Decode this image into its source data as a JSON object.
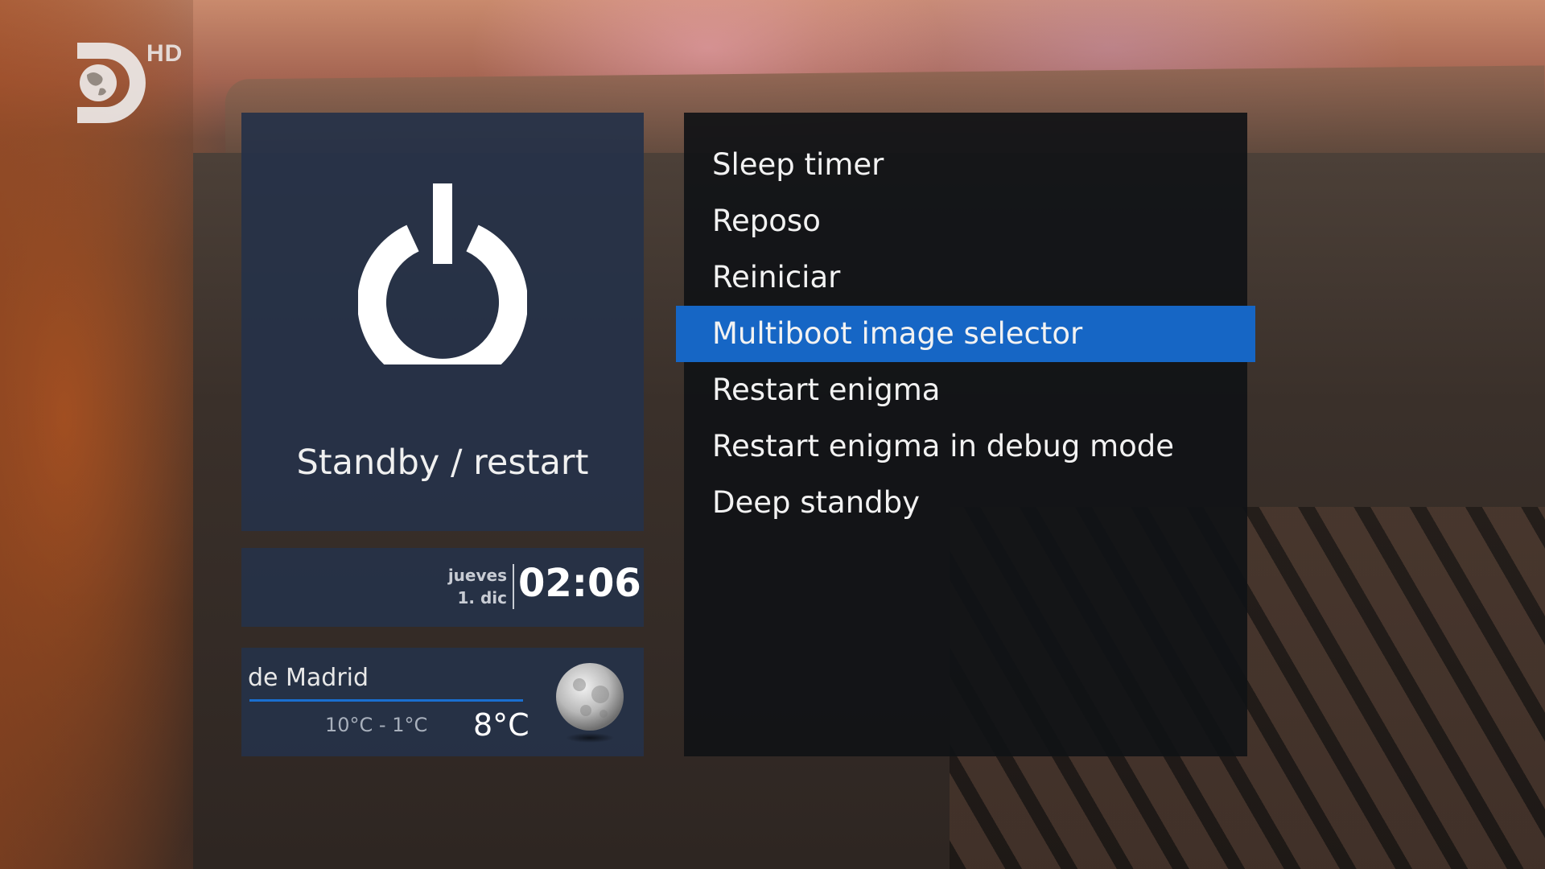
{
  "channel": {
    "badge": "HD"
  },
  "left_panel": {
    "title": "Standby / restart",
    "icon": "power-icon"
  },
  "clock": {
    "weekday": "jueves",
    "date": "1. dic",
    "time": "02:06"
  },
  "weather": {
    "city": "de Madrid",
    "range": "10°C - 1°C",
    "current": "8°C",
    "icon": "moon-icon"
  },
  "menu": {
    "items": [
      {
        "label": "Sleep timer",
        "selected": false
      },
      {
        "label": "Reposo",
        "selected": false
      },
      {
        "label": "Reiniciar",
        "selected": false
      },
      {
        "label": "Multiboot image selector",
        "selected": true
      },
      {
        "label": "Restart enigma",
        "selected": false
      },
      {
        "label": "Restart enigma in debug mode",
        "selected": false
      },
      {
        "label": "Deep standby",
        "selected": false
      }
    ]
  },
  "colors": {
    "accent": "#1666c5",
    "panel": "#263248",
    "menu_bg": "#101216"
  }
}
